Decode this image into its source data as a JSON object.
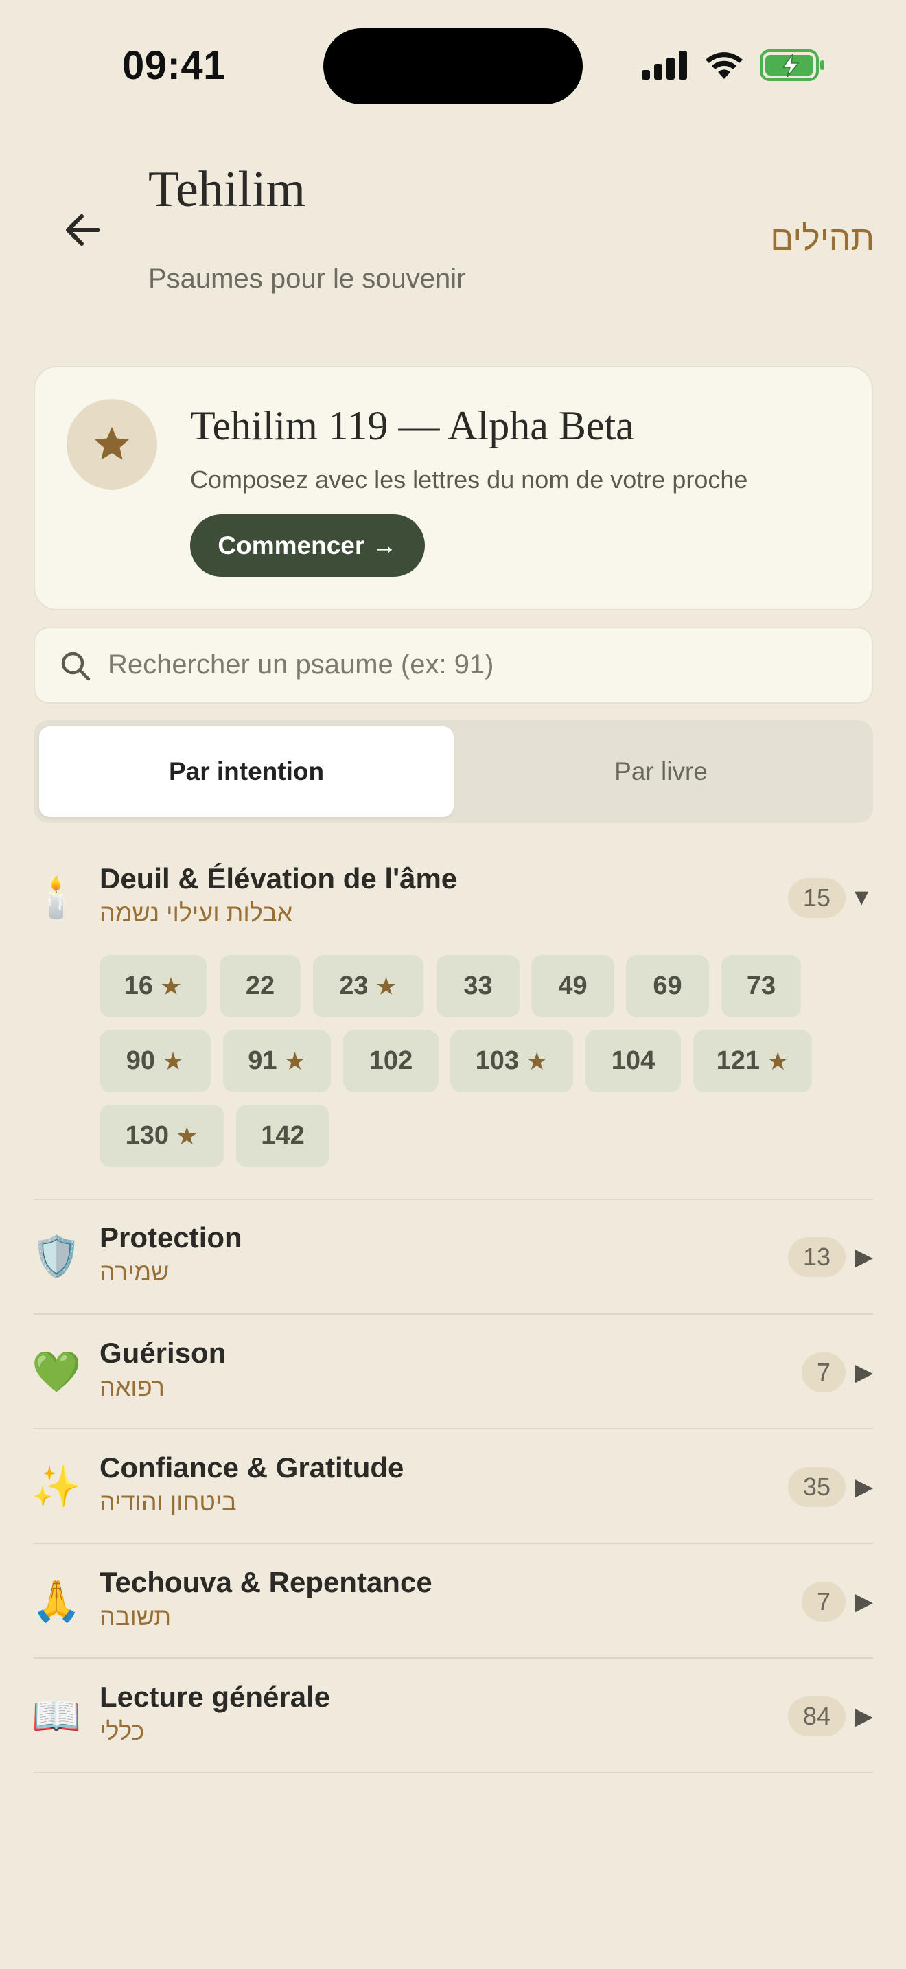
{
  "status": {
    "time": "09:41"
  },
  "header": {
    "title": "Tehilim",
    "subtitle": "Psaumes pour le souvenir",
    "hebrew_title": "תהילים"
  },
  "featured": {
    "title": "Tehilim 119 — Alpha Beta",
    "subtitle": "Composez avec les lettres du nom de votre proche",
    "cta_label": "Commencer →"
  },
  "search": {
    "placeholder": "Rechercher un psaume (ex: 91)"
  },
  "tabs": [
    {
      "label": "Par intention",
      "active": true
    },
    {
      "label": "Par livre",
      "active": false
    }
  ],
  "categories": [
    {
      "emoji": "🕯️",
      "name": "Deuil & Élévation de l'âme",
      "hebrew": "אבלות ועילוי נשמה",
      "count": "15",
      "arrow": "▼",
      "expanded": true,
      "psalms": [
        {
          "num": "16",
          "star": true
        },
        {
          "num": "22",
          "star": false
        },
        {
          "num": "23",
          "star": true
        },
        {
          "num": "33",
          "star": false
        },
        {
          "num": "49",
          "star": false
        },
        {
          "num": "69",
          "star": false
        },
        {
          "num": "73",
          "star": false
        },
        {
          "num": "90",
          "star": true
        },
        {
          "num": "91",
          "star": true
        },
        {
          "num": "102",
          "star": false
        },
        {
          "num": "103",
          "star": true
        },
        {
          "num": "104",
          "star": false
        },
        {
          "num": "121",
          "star": true
        },
        {
          "num": "130",
          "star": true
        },
        {
          "num": "142",
          "star": false
        }
      ]
    },
    {
      "emoji": "🛡️",
      "name": "Protection",
      "hebrew": "שמירה",
      "count": "13",
      "arrow": "▶"
    },
    {
      "emoji": "💚",
      "name": "Guérison",
      "hebrew": "רפואה",
      "count": "7",
      "arrow": "▶"
    },
    {
      "emoji": "✨",
      "name": "Confiance & Gratitude",
      "hebrew": "ביטחון והודיה",
      "count": "35",
      "arrow": "▶"
    },
    {
      "emoji": "🙏",
      "name": "Techouva & Repentance",
      "hebrew": "תשובה",
      "count": "7",
      "arrow": "▶"
    },
    {
      "emoji": "📖",
      "name": "Lecture générale",
      "hebrew": "כללי",
      "count": "84",
      "arrow": "▶"
    }
  ],
  "colors": {
    "background": "#EFEADC",
    "accent_gold": "#9A6F35",
    "button_green": "#3E4D37",
    "chip_bg": "#DEE0D0"
  },
  "icons": {
    "back": "arrow-left-icon",
    "featured": "star-icon",
    "search": "search-icon"
  }
}
